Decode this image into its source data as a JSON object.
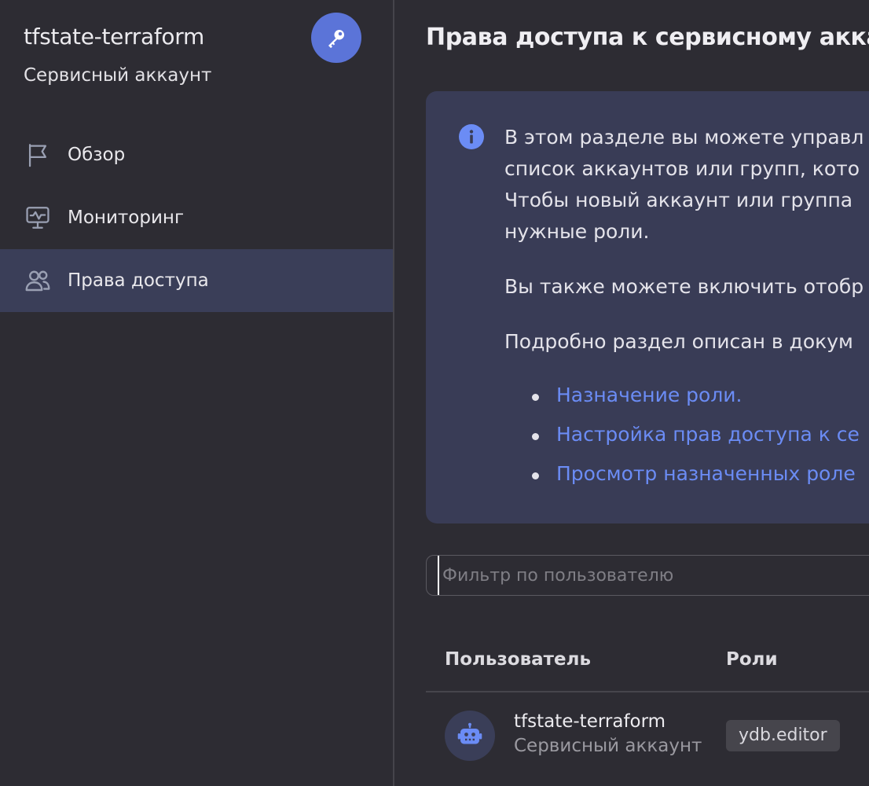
{
  "sidebar": {
    "title": "tfstate-terraform",
    "subtitle": "Сервисный аккаунт",
    "badge_icon": "key-icon",
    "items": [
      {
        "label": "Обзор",
        "icon": "flag-icon",
        "active": false
      },
      {
        "label": "Мониторинг",
        "icon": "monitor-chart-icon",
        "active": false
      },
      {
        "label": "Права доступа",
        "icon": "users-icon",
        "active": true
      }
    ]
  },
  "main": {
    "title": "Права доступа к сервисному аккау",
    "info": {
      "icon": "info-icon",
      "paragraph1": [
        "В этом разделе вы можете управл",
        "список аккаунтов или групп, кото",
        "Чтобы новый аккаунт или группа",
        "нужные роли."
      ],
      "paragraph2": "Вы также можете включить отобр",
      "paragraph3": "Подробно раздел описан в докум",
      "links": [
        "Назначение роли.",
        "Настройка прав доступа к се",
        "Просмотр назначенных роле"
      ]
    },
    "filter": {
      "placeholder": "Фильтр по пользователю",
      "value": ""
    },
    "table": {
      "columns": [
        "Пользователь",
        "Роли"
      ],
      "rows": [
        {
          "name": "tfstate-terraform",
          "type": "Сервисный аккаунт",
          "avatar_icon": "robot-icon",
          "roles": [
            "ydb.editor"
          ]
        }
      ]
    }
  },
  "colors": {
    "background": "#2d2c33",
    "sidebar_active": "#3a3e58",
    "info_box": "#393c56",
    "accent": "#5b74d8",
    "link": "#6b8cf5"
  }
}
